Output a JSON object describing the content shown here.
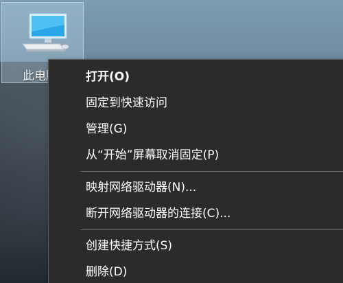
{
  "desktop": {
    "icon": {
      "label": "此电脑",
      "icon_name": "this-pc-icon"
    }
  },
  "context_menu": {
    "groups": [
      [
        {
          "label": "打开(O)",
          "bold": true
        },
        {
          "label": "固定到快速访问",
          "bold": false
        },
        {
          "label": "管理(G)",
          "bold": false
        },
        {
          "label": "从“开始”屏幕取消固定(P)",
          "bold": false
        }
      ],
      [
        {
          "label": "映射网络驱动器(N)...",
          "bold": false
        },
        {
          "label": "断开网络驱动器的连接(C)...",
          "bold": false
        }
      ],
      [
        {
          "label": "创建快捷方式(S)",
          "bold": false
        },
        {
          "label": "删除(D)",
          "bold": false
        }
      ]
    ]
  },
  "colors": {
    "menu_background": "#2b2b2b",
    "menu_text": "#ffffff",
    "separator": "#6a6a6a",
    "selection_highlight": "#cde8ff"
  }
}
